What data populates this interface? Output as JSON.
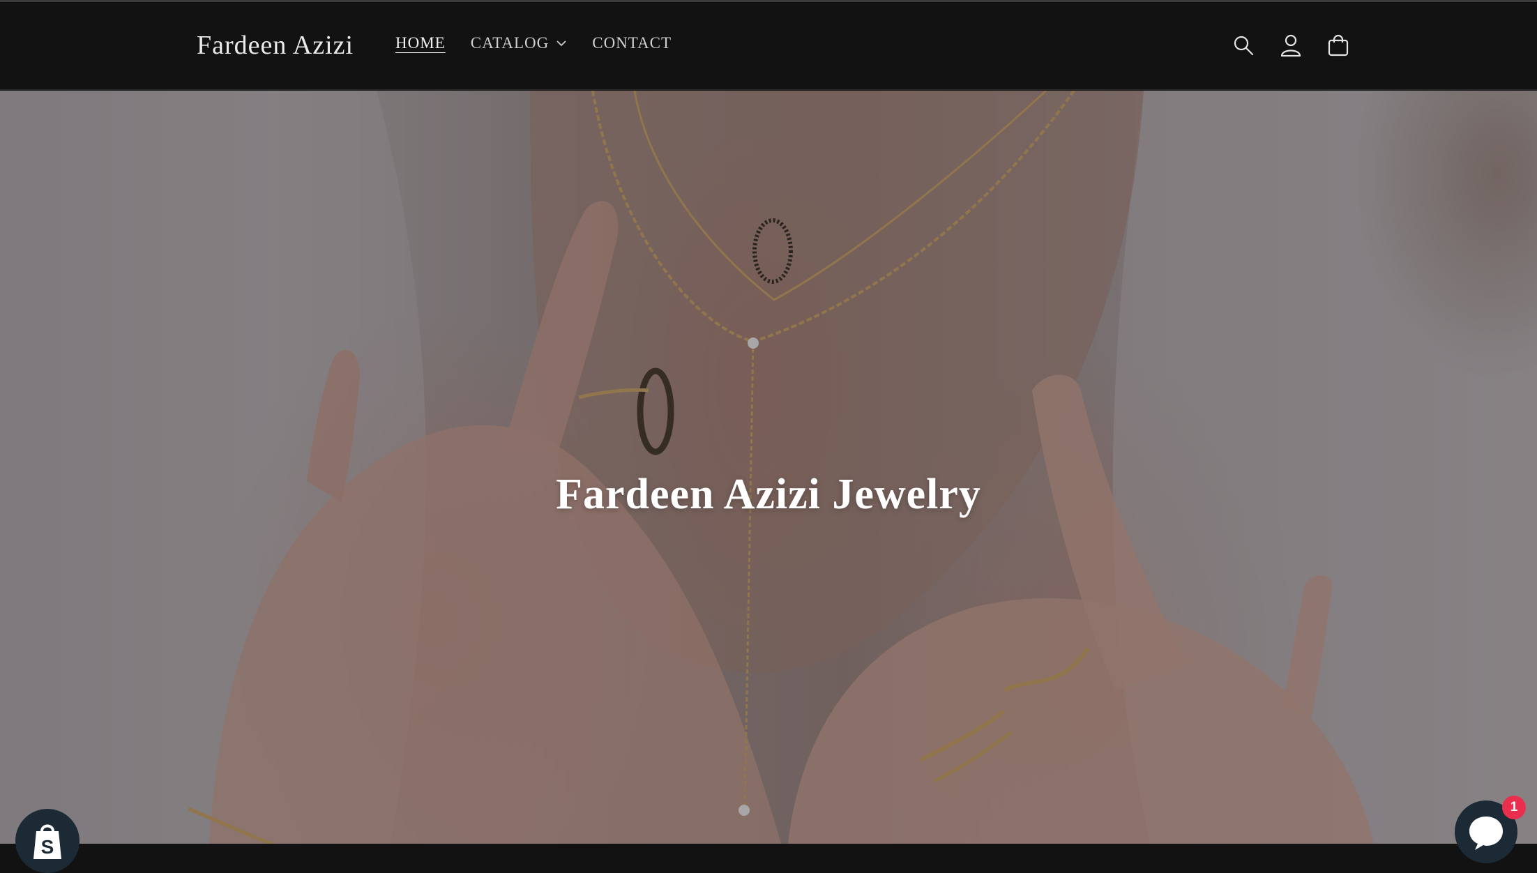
{
  "header": {
    "brand": "Fardeen Azizi",
    "nav": [
      {
        "label": "HOME",
        "active": true
      },
      {
        "label": "CATALOG",
        "has_dropdown": true
      },
      {
        "label": "CONTACT"
      }
    ],
    "icons": [
      "search-icon",
      "account-icon",
      "cart-icon"
    ]
  },
  "hero": {
    "title": "Fardeen Azizi Jewelry",
    "image": "woman-wearing-gold-necklaces-and-rings"
  },
  "widgets": {
    "shopify_icon": "shopify-bag-icon",
    "chat_icon": "chat-bubble-icon",
    "chat_unread_count": "1"
  },
  "colors": {
    "header_bg": "#121212",
    "nav_text": "#cfcfcf",
    "hero_title": "#ffffff",
    "widget_bg": "#1c2a35",
    "badge_red": "#e8304e"
  }
}
